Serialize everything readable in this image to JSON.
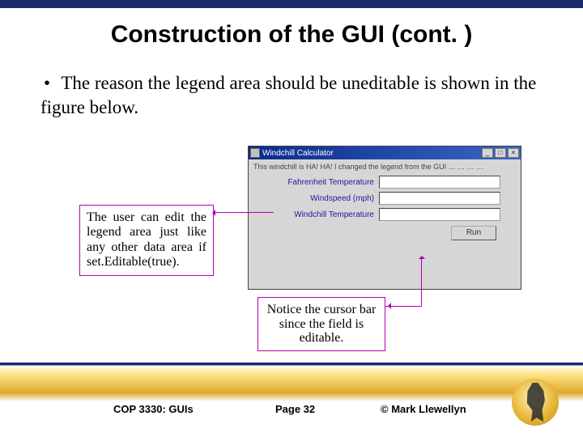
{
  "slide": {
    "title": "Construction of the GUI (cont. )",
    "bullet": "The reason the legend area should be uneditable is shown in the figure below."
  },
  "window": {
    "title": "Windchill Calculator",
    "controls": {
      "min": "_",
      "max": "□",
      "close": "×"
    },
    "legend": "This windchill is HA! HA!  I changed the legend from the GUI … … … …",
    "labels": {
      "temp": "Fahrenheit Temperature",
      "wind": "Windspeed (mph)",
      "chill": "Windchill Temperature"
    },
    "run": "Run"
  },
  "callouts": {
    "c1": "The user can edit the legend area just like any other data area if set.Editable(true).",
    "c2": "Notice the cursor bar since the field is editable."
  },
  "footer": {
    "course": "COP 3330:  GUIs",
    "page": "Page 32",
    "copyright": "© Mark Llewellyn"
  }
}
